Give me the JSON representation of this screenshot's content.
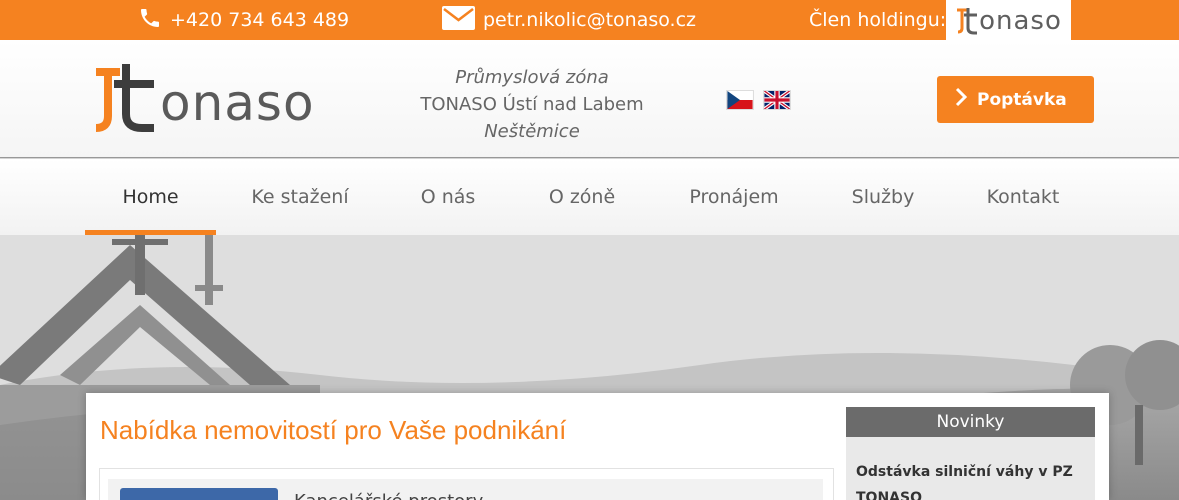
{
  "topbar": {
    "phone": "+420 734 643 489",
    "email": "petr.nikolic@tonaso.cz",
    "holding_label": "Člen holdingu:",
    "holding_logo_text": "onaso",
    "bg_color": "#f58220"
  },
  "header": {
    "logo_text": "onaso",
    "address_line1": "Průmyslová zóna",
    "address_line2": "TONASO Ústí nad Labem",
    "address_line3": "Neštěmice",
    "flags": [
      "czech-flag",
      "uk-flag"
    ],
    "cta_label": "Poptávka"
  },
  "nav": {
    "items": [
      {
        "label": "Home",
        "active": true
      },
      {
        "label": "Ke stažení"
      },
      {
        "label": "O nás"
      },
      {
        "label": "O zóně"
      },
      {
        "label": "Pronájem"
      },
      {
        "label": "Služby"
      },
      {
        "label": "Kontakt"
      }
    ]
  },
  "main": {
    "title": "Nabídka nemovitostí pro Vaše podnikání",
    "panel_text": "Kancelářské prostory",
    "news_title": "Novinky",
    "news_item": "Odstávka silniční váhy v PZ TONASO"
  },
  "colors": {
    "accent": "#f58220",
    "news_header": "#6b6b6b"
  }
}
